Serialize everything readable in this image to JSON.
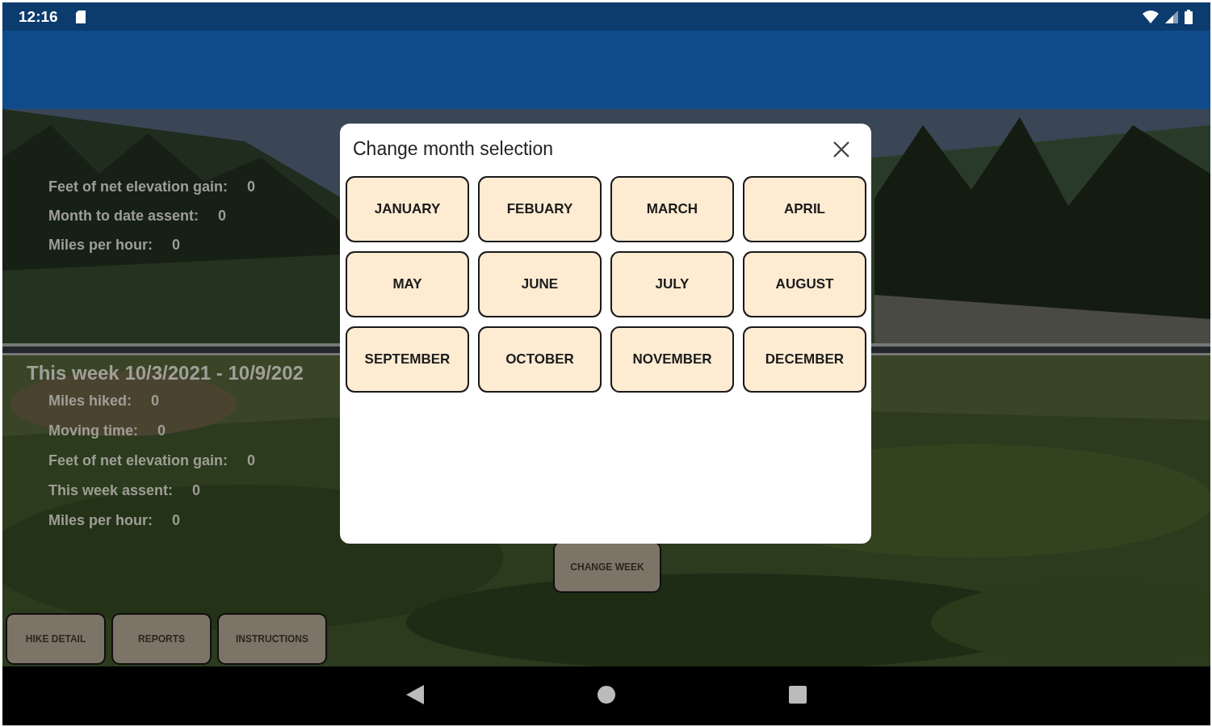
{
  "status_bar": {
    "time": "12:16"
  },
  "month_section": {
    "stats": [
      {
        "label": "Feet of net elevation gain:",
        "value": "0"
      },
      {
        "label": "Month to date assent:",
        "value": "0"
      },
      {
        "label": "Miles per hour:",
        "value": "0"
      }
    ]
  },
  "week_section": {
    "heading": "This week 10/3/2021 - 10/9/202",
    "stats": [
      {
        "label": "Miles hiked:",
        "value": "0"
      },
      {
        "label": "Moving time:",
        "value": "0"
      },
      {
        "label": "Feet of net elevation gain:",
        "value": "0"
      },
      {
        "label": "This week assent:",
        "value": "0"
      },
      {
        "label": "Miles per hour:",
        "value": "0"
      }
    ]
  },
  "change_week_button": "CHANGE WEEK",
  "bottom_buttons": [
    "HIKE DETAIL",
    "REPORTS",
    "INSTRUCTIONS"
  ],
  "dialog": {
    "title": "Change month selection",
    "months": [
      "JANUARY",
      "FEBUARY",
      "MARCH",
      "APRIL",
      "MAY",
      "JUNE",
      "JULY",
      "AUGUST",
      "SEPTEMBER",
      "OCTOBER",
      "NOVEMBER",
      "DECEMBER"
    ]
  }
}
